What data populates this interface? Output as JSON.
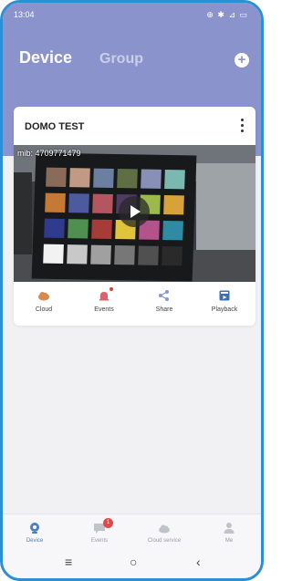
{
  "status_bar": {
    "time": "13:04",
    "icons": "⊕ ✱ ⊿ ▭"
  },
  "header": {
    "tab_device": "Device",
    "tab_group": "Group",
    "add_icon": "plus-circle-icon",
    "background": "#8a93cc"
  },
  "device_card": {
    "name": "DOMO TEST",
    "watermark": "mib: 4709771479",
    "actions": [
      {
        "label": "Cloud",
        "icon": "cloud-icon",
        "color": "#d98a4e"
      },
      {
        "label": "Events",
        "icon": "bell-icon",
        "color": "#e0606e"
      },
      {
        "label": "Share",
        "icon": "share-icon",
        "color": "#8b96c9"
      },
      {
        "label": "Playback",
        "icon": "playback-icon",
        "color": "#3d6fb8"
      }
    ]
  },
  "bottom_nav": {
    "items": [
      {
        "label": "Device",
        "icon": "camera-icon",
        "active": true
      },
      {
        "label": "Events",
        "icon": "message-icon",
        "badge": "1"
      },
      {
        "label": "Cloud service",
        "icon": "cloud-icon"
      },
      {
        "label": "Me",
        "icon": "person-icon"
      }
    ]
  },
  "android_nav": {
    "menu": "≡",
    "home": "○",
    "back": "‹"
  }
}
